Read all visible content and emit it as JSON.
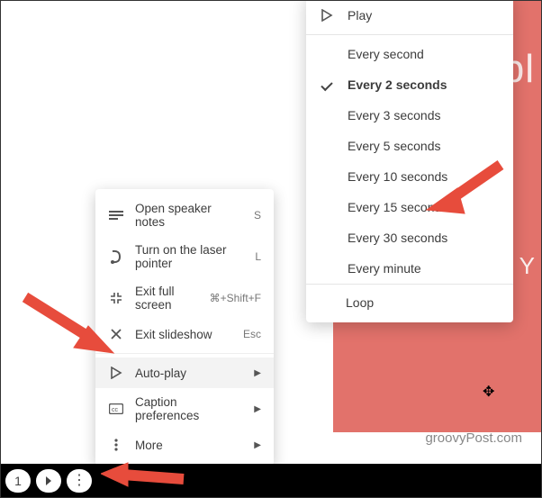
{
  "slide": {
    "title_fragment": "Simpl",
    "by_fragment": "By Y"
  },
  "watermark": "groovyPost.com",
  "toolbar": {
    "slide_number": "1"
  },
  "menu1": {
    "open_notes": "Open speaker notes",
    "open_notes_key": "S",
    "laser": "Turn on the laser pointer",
    "laser_key": "L",
    "exit_fs": "Exit full screen",
    "exit_fs_key": "⌘+Shift+F",
    "exit_show": "Exit slideshow",
    "exit_show_key": "Esc",
    "autoplay": "Auto-play",
    "captions": "Caption preferences",
    "more": "More"
  },
  "menu2": {
    "play": "Play",
    "items": [
      "Every second",
      "Every 2 seconds",
      "Every 3 seconds",
      "Every 5 seconds",
      "Every 10 seconds",
      "Every 15 seconds",
      "Every 30 seconds",
      "Every minute"
    ],
    "selected_index": 1,
    "loop": "Loop"
  }
}
